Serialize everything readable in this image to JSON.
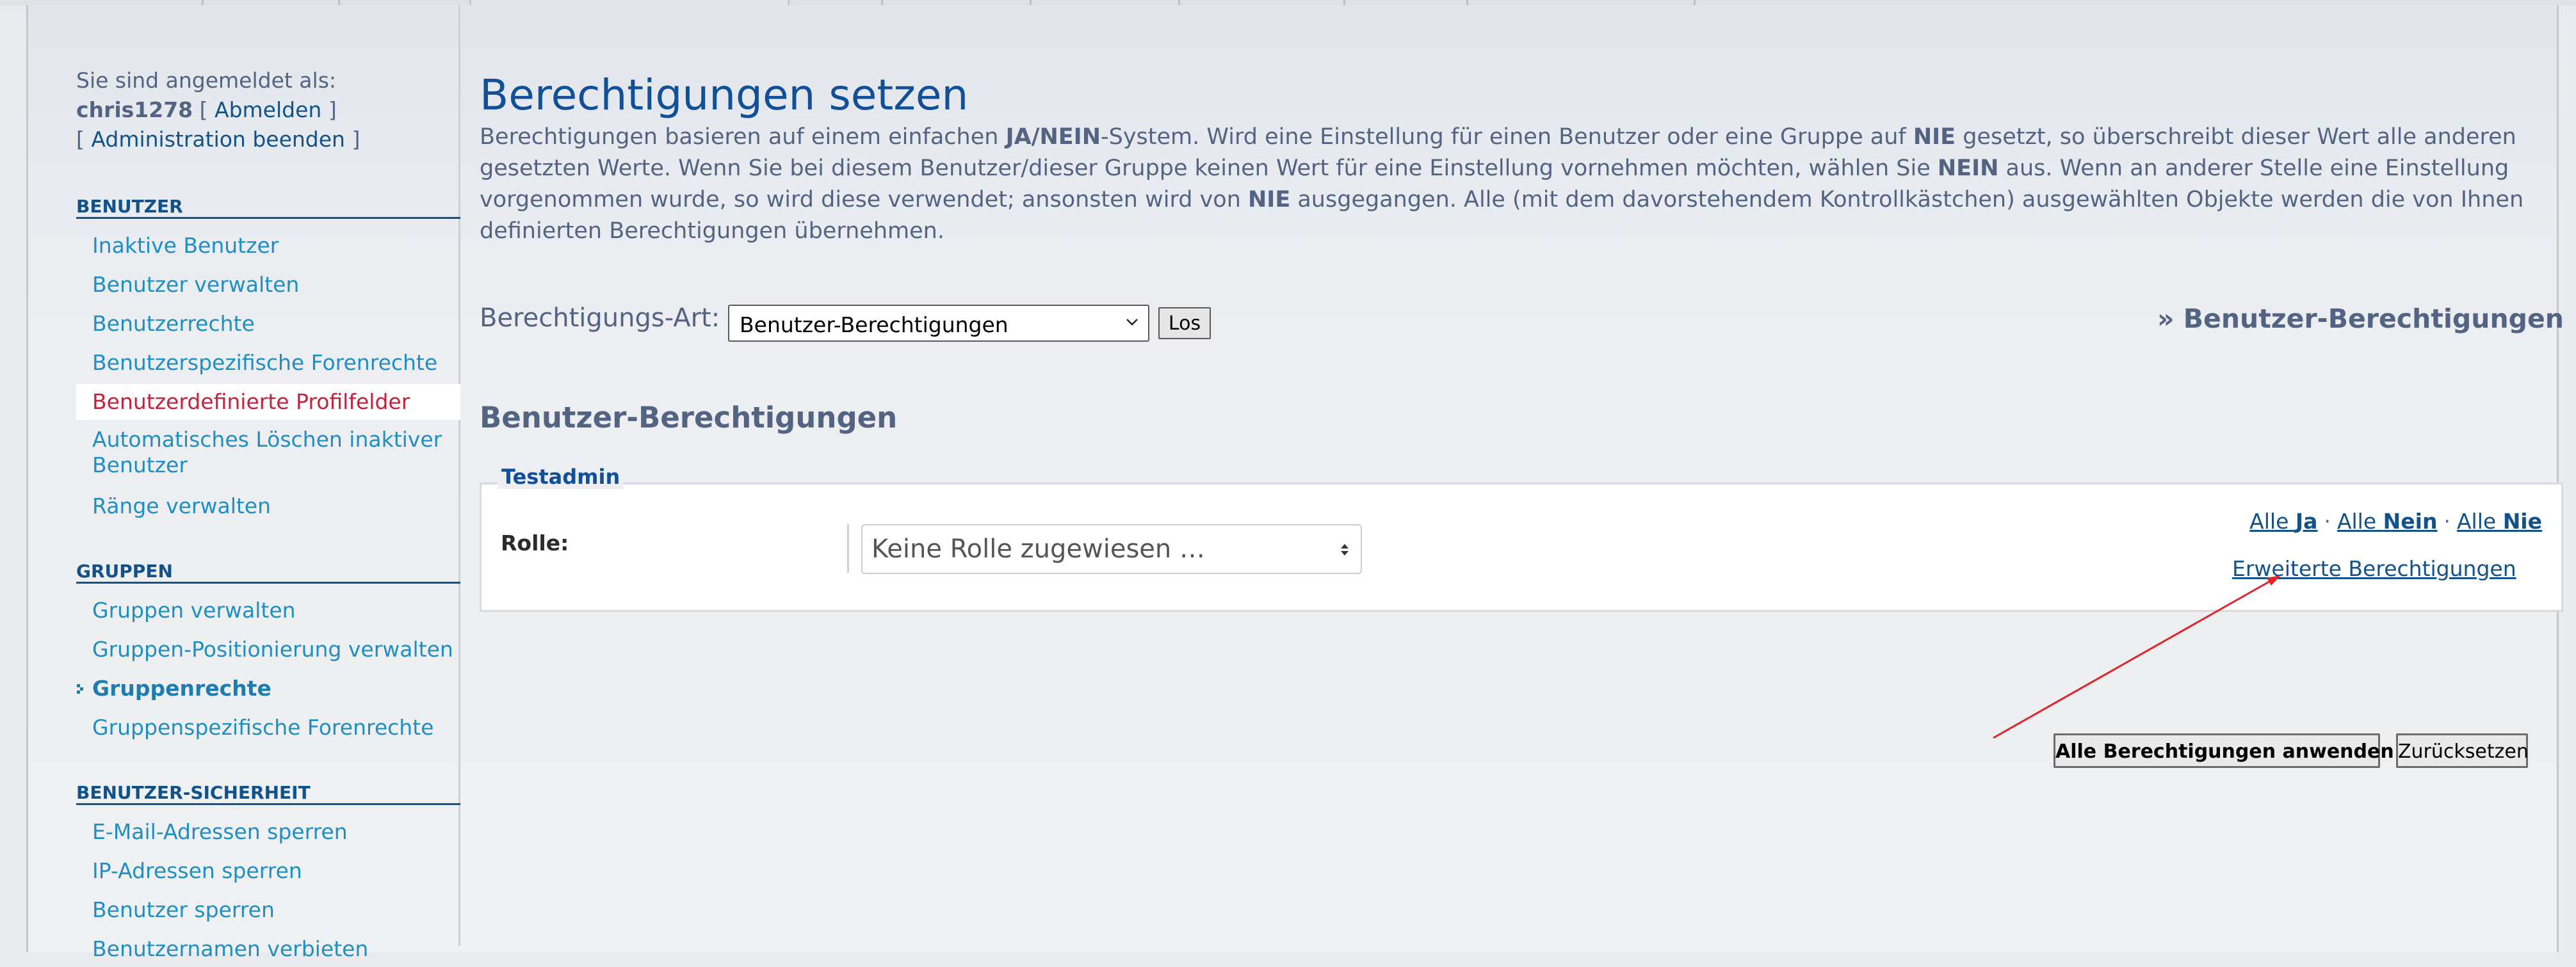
{
  "sidebar": {
    "logged_in_as": "Sie sind angemeldet als:",
    "username": "chris1278",
    "logout_open": "[",
    "logout": "Abmelden",
    "logout_close": "]",
    "admin_end_open": "[",
    "admin_end": "Administration beenden",
    "admin_end_close": "]",
    "sections": [
      {
        "title": "BENUTZER",
        "items": [
          "Inaktive Benutzer",
          "Benutzer verwalten",
          "Benutzerrechte",
          "Benutzerspezifische Forenrechte",
          "Benutzerdefinierte Profilfelder",
          "Automatisches Löschen inaktiver Benutzer",
          "Ränge verwalten"
        ]
      },
      {
        "title": "GRUPPEN",
        "items": [
          "Gruppen verwalten",
          "Gruppen-Positionierung verwalten",
          "Gruppenrechte",
          "Gruppenspezifische Forenrechte"
        ]
      },
      {
        "title": "BENUTZER-SICHERHEIT",
        "items": [
          "E-Mail-Adressen sperren",
          "IP-Adressen sperren",
          "Benutzer sperren",
          "Benutzernamen verbieten"
        ]
      }
    ]
  },
  "main": {
    "title": "Berechtigungen setzen",
    "intro": {
      "p1": "Berechtigungen basieren auf einem einfachen ",
      "b1": "JA/NEIN",
      "p2": "-System. Wird eine Einstellung für einen Benutzer oder eine Gruppe auf ",
      "b2": "NIE",
      "p3": " gesetzt, so überschreibt dieser Wert alle anderen gesetzten Werte. Wenn Sie bei diesem Benutzer/dieser Gruppe keinen Wert für eine Einstellung vornehmen möchten, wählen Sie ",
      "b3": "NEIN",
      "p4": " aus. Wenn an anderer Stelle eine Einstellung vorgenommen wurde, so wird diese verwendet; ansonsten wird von ",
      "b4": "NIE",
      "p5": " ausgegangen. Alle (mit dem davorstehendem Kontrollkästchen) ausgewählten Objekte werden die von Ihnen definierten Berechtigungen übernehmen."
    },
    "perm_type_label": "Berechtigungs-Art:",
    "perm_type_value": "Benutzer-Berechtigungen",
    "go_button": "Los",
    "breadcrumb": "» Benutzer-Berechtigungen",
    "section_title": "Benutzer-Berechtigungen",
    "fieldset": {
      "legend": "Testadmin",
      "role_label": "Rolle:",
      "role_placeholder": "Keine Rolle zugewiesen …",
      "all_yes_prefix": "Alle ",
      "all_yes": "Ja",
      "all_no_prefix": "Alle ",
      "all_no": "Nein",
      "all_never_prefix": "Alle ",
      "all_never": "Nie",
      "separator": "·",
      "advanced": "Erweiterte Berechtigungen"
    },
    "apply_button": "Alle Berechtigungen anwenden",
    "reset_button": "Zurücksetzen"
  },
  "colors": {
    "title_blue": "#115098",
    "link_blue": "#105289",
    "menu_link": "#1f8fc3",
    "active_red": "#c4213f",
    "text_gray": "#536482",
    "annotation_arrow": "#e0242b"
  },
  "icons": {
    "current_bullet": "bullet-icon",
    "select_chevron": "chevron-down-icon",
    "role_arrows": "updown-arrows-icon"
  }
}
